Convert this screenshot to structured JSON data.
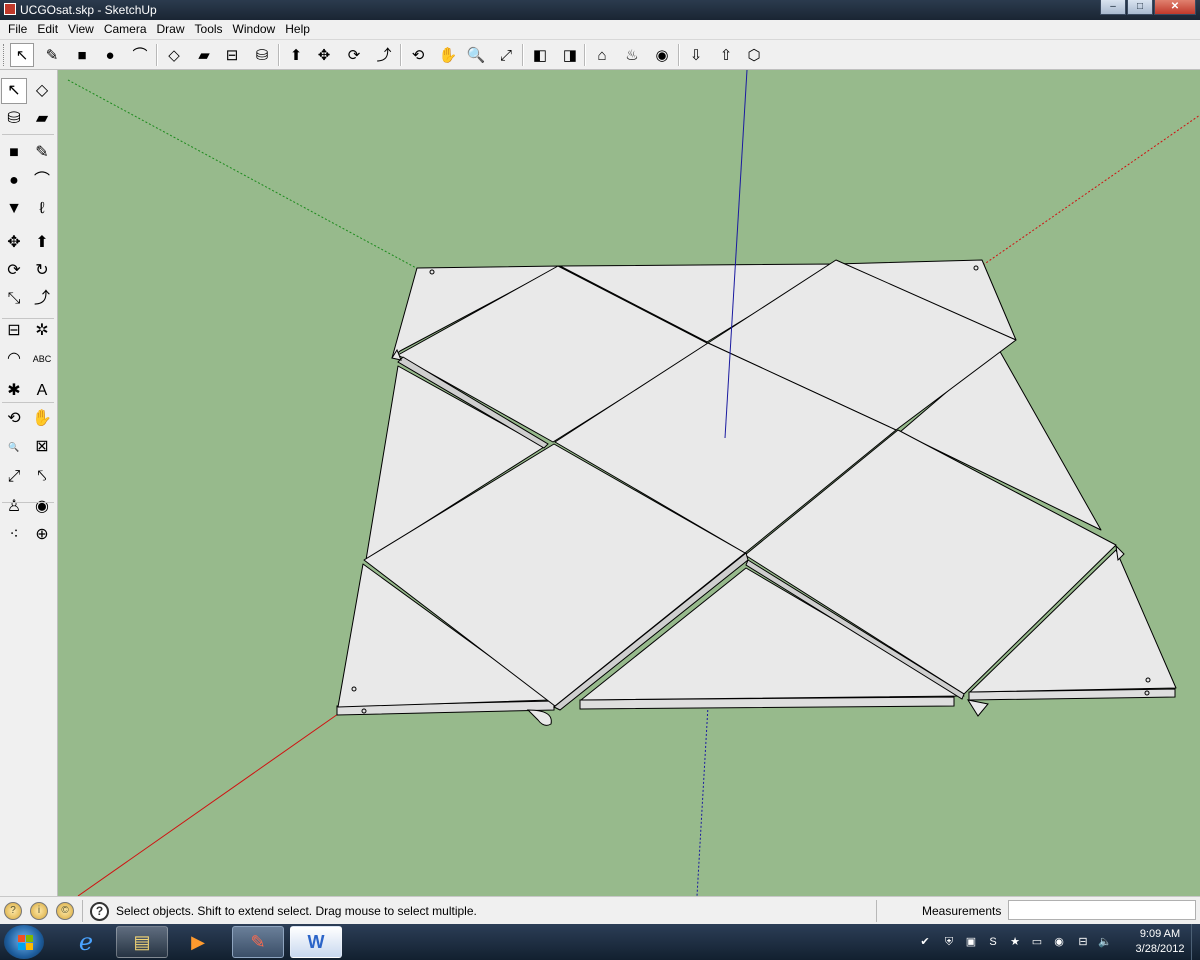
{
  "window": {
    "title": "UCGOsat.skp - SketchUp",
    "controls": {
      "minimize": "–",
      "maximize": "□",
      "close": "✕"
    }
  },
  "menu": {
    "items": [
      "File",
      "Edit",
      "View",
      "Camera",
      "Draw",
      "Tools",
      "Window",
      "Help"
    ]
  },
  "top_toolbar": {
    "tools": [
      {
        "name": "select-tool",
        "glyph": "↖"
      },
      {
        "name": "pencil-tool",
        "glyph": "✎"
      },
      {
        "name": "rectangle-tool",
        "glyph": "■"
      },
      {
        "name": "circle-tool",
        "glyph": "●"
      },
      {
        "name": "arc-tool",
        "glyph": "⌒"
      },
      {
        "name": "make-component-tool",
        "glyph": "◇"
      },
      {
        "name": "eraser-tool",
        "glyph": "▰"
      },
      {
        "name": "tape-measure-tool",
        "glyph": "⊟"
      },
      {
        "name": "paint-bucket-tool",
        "glyph": "⛁"
      },
      {
        "name": "push-pull-tool",
        "glyph": "⬆"
      },
      {
        "name": "move-tool",
        "glyph": "✥"
      },
      {
        "name": "rotate-tool",
        "glyph": "⟳"
      },
      {
        "name": "follow-me-tool",
        "glyph": "⤴"
      },
      {
        "name": "orbit-tool",
        "glyph": "⟲"
      },
      {
        "name": "pan-tool",
        "glyph": "✋"
      },
      {
        "name": "zoom-tool",
        "glyph": "🔍"
      },
      {
        "name": "zoom-extents-tool",
        "glyph": "⤢"
      },
      {
        "name": "previous-view-tool",
        "glyph": "◧"
      },
      {
        "name": "next-view-tool",
        "glyph": "◨"
      },
      {
        "name": "add-location-tool",
        "glyph": "⌂"
      },
      {
        "name": "toggle-terrain-tool",
        "glyph": "♨"
      },
      {
        "name": "google-earth-tool",
        "glyph": "◉"
      },
      {
        "name": "get-models-tool",
        "glyph": "⇩"
      },
      {
        "name": "share-model-tool",
        "glyph": "⇧"
      },
      {
        "name": "share-component-tool",
        "glyph": "⬡"
      }
    ]
  },
  "left_toolbar": {
    "tools": [
      {
        "name": "select-tool",
        "glyph": "↖"
      },
      {
        "name": "make-component-tool",
        "glyph": "◇"
      },
      {
        "name": "paint-bucket-tool",
        "glyph": "⛁"
      },
      {
        "name": "eraser-tool",
        "glyph": "▰"
      },
      {
        "name": "rectangle-tool",
        "glyph": "■"
      },
      {
        "name": "line-tool",
        "glyph": "✎"
      },
      {
        "name": "circle-tool",
        "glyph": "●"
      },
      {
        "name": "arc-tool",
        "glyph": "⌒"
      },
      {
        "name": "polygon-tool",
        "glyph": "▼"
      },
      {
        "name": "freehand-tool",
        "glyph": "ℓ"
      },
      {
        "name": "move-tool",
        "glyph": "✥"
      },
      {
        "name": "push-pull-tool",
        "glyph": "⬆"
      },
      {
        "name": "rotate-tool",
        "glyph": "⟳"
      },
      {
        "name": "follow-me-tool",
        "glyph": "↻"
      },
      {
        "name": "scale-tool",
        "glyph": "⤡"
      },
      {
        "name": "offset-tool",
        "glyph": "⤴"
      },
      {
        "name": "tape-measure-tool",
        "glyph": "⊟"
      },
      {
        "name": "dimension-tool",
        "glyph": "✲"
      },
      {
        "name": "protractor-tool",
        "glyph": "◠"
      },
      {
        "name": "text-tool",
        "glyph": "ABC"
      },
      {
        "name": "axes-tool",
        "glyph": "✱"
      },
      {
        "name": "3d-text-tool",
        "glyph": "A"
      },
      {
        "name": "orbit-tool",
        "glyph": "⟲"
      },
      {
        "name": "pan-tool",
        "glyph": "✋"
      },
      {
        "name": "zoom-tool",
        "glyph": "🔍"
      },
      {
        "name": "zoom-window-tool",
        "glyph": "⊠"
      },
      {
        "name": "zoom-extents-tool",
        "glyph": "⤢"
      },
      {
        "name": "previous-view-tool",
        "glyph": "⤣"
      },
      {
        "name": "position-camera-tool",
        "glyph": "♙"
      },
      {
        "name": "look-around-tool",
        "glyph": "◉"
      },
      {
        "name": "walk-tool",
        "glyph": "⁖"
      },
      {
        "name": "section-plane-tool",
        "glyph": "⊕"
      }
    ]
  },
  "status": {
    "message": "Select objects. Shift to extend select. Drag mouse to select multiple.",
    "measurements_label": "Measurements",
    "measurements_value": ""
  },
  "taskbar": {
    "apps": [
      {
        "name": "internet-explorer-taskbar-icon",
        "glyph": "e"
      },
      {
        "name": "file-explorer-taskbar-icon",
        "glyph": "▤"
      },
      {
        "name": "media-player-taskbar-icon",
        "glyph": "▶"
      },
      {
        "name": "sketchup-taskbar-icon",
        "glyph": "✎"
      },
      {
        "name": "word-taskbar-icon",
        "glyph": "W"
      }
    ],
    "clock_time": "9:09 AM",
    "clock_date": "3/28/2012"
  },
  "colors": {
    "viewport_background": "#97ba8c",
    "model_face": "#e9e9e9",
    "axis_red": "#d01010",
    "axis_green": "#1d8a1d",
    "axis_blue": "#1a1aa0"
  }
}
